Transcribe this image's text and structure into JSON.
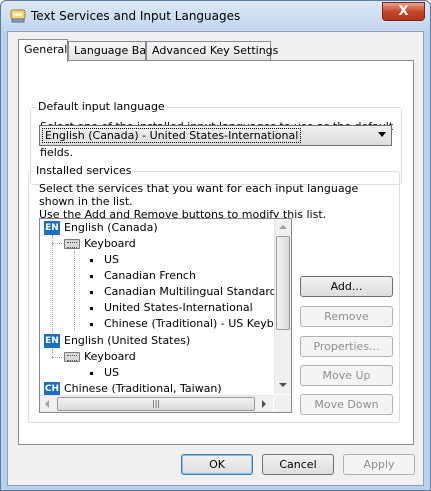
{
  "window": {
    "title": "Text Services and Input Languages",
    "close_label": "X"
  },
  "tabs": [
    {
      "label": "General",
      "active": true
    },
    {
      "label": "Language Bar",
      "active": false
    },
    {
      "label": "Advanced Key Settings",
      "active": false
    }
  ],
  "default_language": {
    "legend": "Default input language",
    "description_line1": "Select one of the installed input languages to use as the default for all input",
    "description_line2": "fields.",
    "selected": "English (Canada) - United States-International"
  },
  "installed_services": {
    "legend": "Installed services",
    "description_line1": "Select the services that you want for each input language shown in the list.",
    "description_line2": "Use the Add and Remove buttons to modify this list.",
    "tree": {
      "lang1": {
        "badge": "EN",
        "name": "English (Canada)"
      },
      "lang1_keyboard": "Keyboard",
      "lang1_items": [
        "US",
        "Canadian French",
        "Canadian Multilingual Standard",
        "United States-International",
        "Chinese (Traditional) - US Keyboard"
      ],
      "lang2": {
        "badge": "EN",
        "name": "English (United States)"
      },
      "lang2_keyboard": "Keyboard",
      "lang2_items": [
        "US"
      ],
      "lang3": {
        "badge": "CH",
        "name": "Chinese (Traditional, Taiwan)"
      }
    },
    "buttons": {
      "add": "Add...",
      "remove": "Remove",
      "properties": "Properties...",
      "move_up": "Move Up",
      "move_down": "Move Down"
    }
  },
  "footer": {
    "ok": "OK",
    "cancel": "Cancel",
    "apply": "Apply"
  },
  "colors": {
    "badge": "#1a6fc4",
    "close": "#c9462a"
  }
}
